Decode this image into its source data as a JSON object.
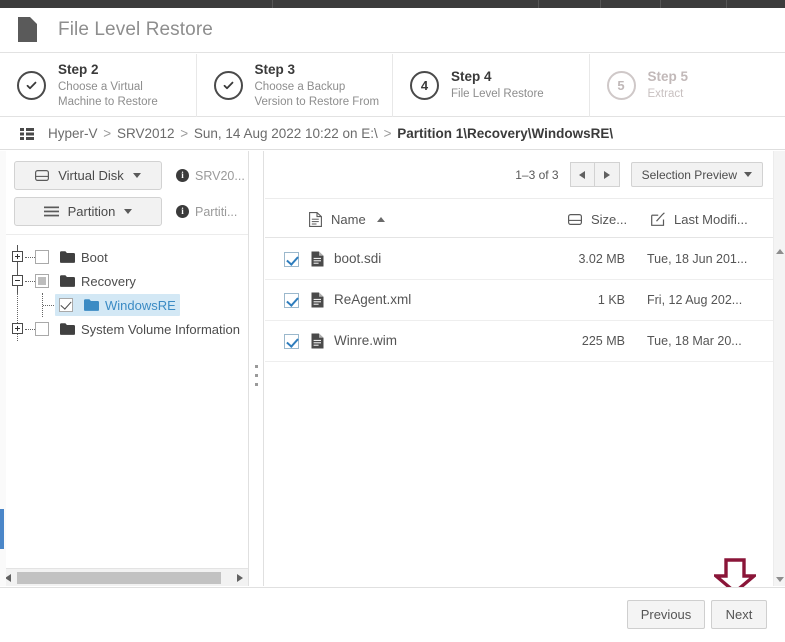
{
  "window": {
    "title": "File Level Restore",
    "title_icon": "document-icon"
  },
  "wizard": {
    "steps": [
      {
        "num": "Step 2",
        "badge": "check",
        "desc": "Choose a Virtual\nMachine to Restore",
        "desc_l1": "Choose a Virtual",
        "desc_l2": "Machine to Restore",
        "state": "done"
      },
      {
        "num": "Step 3",
        "badge": "check",
        "desc_l1": "Choose a Backup",
        "desc_l2": "Version to Restore From",
        "state": "done"
      },
      {
        "num": "Step 4",
        "badge": "4",
        "desc_l1": "File Level Restore",
        "desc_l2": "",
        "state": "current"
      },
      {
        "num": "Step 5",
        "badge": "5",
        "desc_l1": "Extract",
        "desc_l2": "",
        "state": "inactive"
      }
    ]
  },
  "breadcrumb": {
    "icon": "grid-list-icon",
    "items": [
      "Hyper-V",
      "SRV2012",
      "Sun, 14 Aug 2022 10:22 on E:\\"
    ],
    "separator": ">",
    "current": "Partition 1\\Recovery\\WindowsRE\\"
  },
  "sidebar": {
    "virtual_disk": {
      "label": "Virtual Disk",
      "icon": "disk-icon",
      "caret": "chevron-down-icon"
    },
    "virtual_disk_info": {
      "label": "SRV20...",
      "icon": "info-icon"
    },
    "partition": {
      "label": "Partition",
      "icon": "hamburger-icon",
      "caret": "chevron-down-icon"
    },
    "partition_info": {
      "label": "Partiti...",
      "icon": "info-icon"
    },
    "tree": [
      {
        "label": "Boot",
        "expander": "plus",
        "check": "unchecked",
        "depth": 0
      },
      {
        "label": "Recovery",
        "expander": "minus",
        "check": "partial",
        "depth": 0
      },
      {
        "label": "WindowsRE",
        "expander": "none",
        "check": "checked",
        "depth": 1,
        "selected": true
      },
      {
        "label": "System Volume Information",
        "expander": "plus",
        "check": "unchecked",
        "depth": 0
      }
    ]
  },
  "filelist": {
    "pager": {
      "count_label": "1–3 of 3",
      "prev_icon": "chevron-left-icon",
      "next_icon": "chevron-right-icon"
    },
    "selection_preview": {
      "label": "Selection Preview",
      "caret": "chevron-down-icon"
    },
    "columns": [
      {
        "key": "name",
        "label": "Name",
        "icon": "file-icon",
        "sorted": "asc",
        "sort_icon": "caret-up-icon"
      },
      {
        "key": "size",
        "label": "Size...",
        "icon": "disk-icon"
      },
      {
        "key": "modified",
        "label": "Last Modifi...",
        "icon": "edit-icon"
      }
    ],
    "rows": [
      {
        "checked": true,
        "icon": "file-icon",
        "name": "boot.sdi",
        "size": "3.02 MB",
        "modified": "Tue, 18 Jun 201..."
      },
      {
        "checked": true,
        "icon": "file-icon",
        "name": "ReAgent.xml",
        "size": "1 KB",
        "modified": "Fri, 12 Aug 202..."
      },
      {
        "checked": true,
        "icon": "file-icon",
        "name": "Winre.wim",
        "size": "225 MB",
        "modified": "Tue, 18 Mar 20..."
      }
    ]
  },
  "footer": {
    "previous_label": "Previous",
    "next_label": "Next"
  },
  "annotation": {
    "arrow": "down-arrow-annotation",
    "color": "#8a1538"
  },
  "colors": {
    "accent_blue": "#3b8bc4",
    "selection_bg": "#d3e8f5",
    "checkbox_blue": "#2e7dbd",
    "chrome_dark": "#3c3c3c",
    "annotation_maroon": "#8a1538"
  }
}
